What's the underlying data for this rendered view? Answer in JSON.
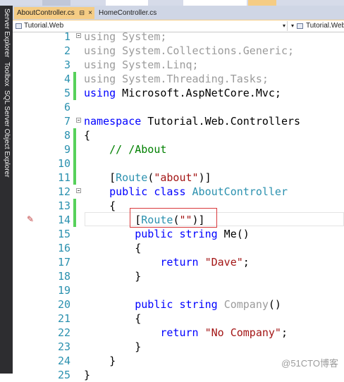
{
  "tabs": [
    {
      "label": "AboutController.cs",
      "active": true
    },
    {
      "label": "HomeController.cs",
      "active": false
    }
  ],
  "tab_close_glyph": "×",
  "tab_pin_glyph": "⊟",
  "side_tabs": [
    "Server Explorer",
    "Toolbox",
    "SQL Server Object Explorer"
  ],
  "nav": {
    "project": "Tutorial.Web",
    "type": "Tutorial.Web.Co"
  },
  "code_lines": [
    {
      "n": "1",
      "text": "using System;",
      "mark": "",
      "fold": true
    },
    {
      "n": "2",
      "text": "using System.Collections.Generic;",
      "mark": "",
      "fold": false
    },
    {
      "n": "3",
      "text": "using System.Linq;",
      "mark": "",
      "fold": false
    },
    {
      "n": "4",
      "text": "using System.Threading.Tasks;",
      "mark": "green",
      "fold": false
    },
    {
      "n": "5",
      "text": "using Microsoft.AspNetCore.Mvc;",
      "mark": "green",
      "fold": false
    },
    {
      "n": "6",
      "text": "",
      "mark": "",
      "fold": false
    },
    {
      "n": "7",
      "text": "namespace Tutorial.Web.Controllers",
      "mark": "",
      "fold": true
    },
    {
      "n": "8",
      "text": "{",
      "mark": "green",
      "fold": false
    },
    {
      "n": "9",
      "text": "    // /About",
      "mark": "green",
      "fold": false
    },
    {
      "n": "10",
      "text": "",
      "mark": "green",
      "fold": false
    },
    {
      "n": "11",
      "text": "    [Route(\"about\")]",
      "mark": "green",
      "fold": false
    },
    {
      "n": "12",
      "text": "    public class AboutController",
      "mark": "",
      "fold": true
    },
    {
      "n": "13",
      "text": "    {",
      "mark": "green",
      "fold": false
    },
    {
      "n": "14",
      "text": "        [Route(\"\")]",
      "mark": "green",
      "fold": false
    },
    {
      "n": "15",
      "text": "        public string Me()",
      "mark": "",
      "fold": false
    },
    {
      "n": "16",
      "text": "        {",
      "mark": "",
      "fold": false
    },
    {
      "n": "17",
      "text": "            return \"Dave\";",
      "mark": "",
      "fold": false
    },
    {
      "n": "18",
      "text": "        }",
      "mark": "",
      "fold": false
    },
    {
      "n": "19",
      "text": "",
      "mark": "",
      "fold": false
    },
    {
      "n": "20",
      "text": "        public string Company()",
      "mark": "",
      "fold": false
    },
    {
      "n": "21",
      "text": "        {",
      "mark": "",
      "fold": false
    },
    {
      "n": "22",
      "text": "            return \"No Company\";",
      "mark": "",
      "fold": false
    },
    {
      "n": "23",
      "text": "        }",
      "mark": "",
      "fold": false
    },
    {
      "n": "24",
      "text": "    }",
      "mark": "",
      "fold": false
    },
    {
      "n": "25",
      "text": "}",
      "mark": "",
      "fold": false
    }
  ],
  "watermark": "@51CTO博客",
  "colors": {
    "keyword": "#0000ff",
    "type": "#2b91af",
    "string": "#a31515",
    "comment": "#008000",
    "unused_using": "#9b9b9b",
    "change_green": "#57d15b",
    "highlight_red": "#d9393b",
    "active_tab": "#f5cc84"
  }
}
